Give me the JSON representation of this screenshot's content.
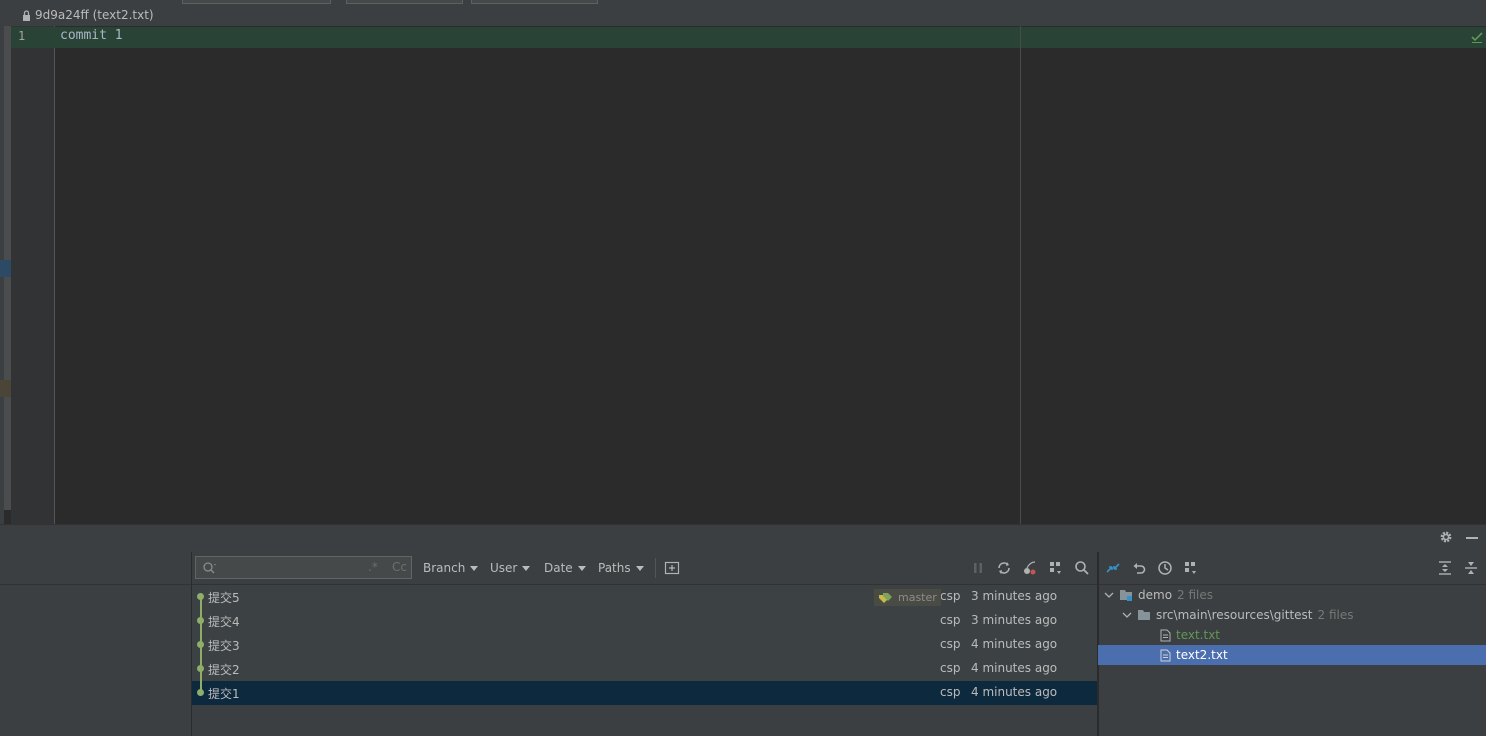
{
  "editor": {
    "file_label": "9d9a24ff (text2.txt)",
    "line_number": "1",
    "code": "commit 1"
  },
  "log_toolbar": {
    "search_placeholder": "",
    "regex_label": ".*",
    "case_label": "Cc",
    "filters": [
      {
        "label": "Branch"
      },
      {
        "label": "User"
      },
      {
        "label": "Date"
      },
      {
        "label": "Paths"
      }
    ]
  },
  "commits": [
    {
      "subject": "提交5",
      "author": "csp",
      "date": "3 minutes ago",
      "ref": "master"
    },
    {
      "subject": "提交4",
      "author": "csp",
      "date": "3 minutes ago"
    },
    {
      "subject": "提交3",
      "author": "csp",
      "date": "4 minutes ago"
    },
    {
      "subject": "提交2",
      "author": "csp",
      "date": "4 minutes ago"
    },
    {
      "subject": "提交1",
      "author": "csp",
      "date": "4 minutes ago",
      "selected": true
    }
  ],
  "changes": {
    "root": {
      "name": "demo",
      "count": "2 files"
    },
    "dir": {
      "name": "src\\main\\resources\\gittest",
      "count": "2 files"
    },
    "files": [
      {
        "name": "text.txt",
        "color": "#629755"
      },
      {
        "name": "text2.txt",
        "color": "#bbbbbb",
        "selected": true
      }
    ]
  },
  "colors": {
    "accent": "#4b6eaf",
    "graph": "#8fae6a",
    "added_line": "#294436",
    "selected_row": "#0d293e"
  }
}
